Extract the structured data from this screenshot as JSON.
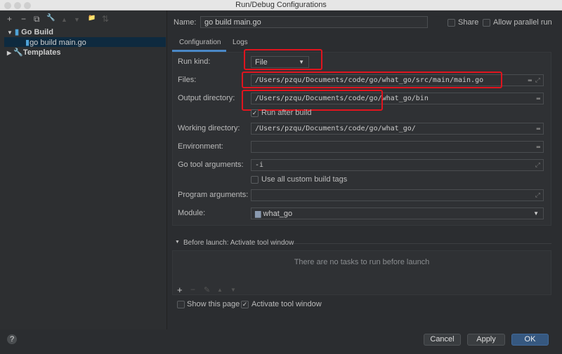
{
  "window": {
    "title": "Run/Debug Configurations"
  },
  "sidebar": {
    "toolbar": [
      "+",
      "−",
      "⧉",
      "🔧",
      "▲",
      "▼",
      "📁",
      "⇅"
    ],
    "tree": [
      {
        "label": "Go Build",
        "expanded": true
      },
      {
        "label": "go build main.go",
        "selected": true
      },
      {
        "label": "Templates",
        "expanded": false
      }
    ]
  },
  "header": {
    "name_label": "Name:",
    "name_value": "go build main.go",
    "share_label": "Share",
    "share_checked": false,
    "parallel_label": "Allow parallel run",
    "parallel_checked": false
  },
  "tabs": [
    {
      "label": "Configuration",
      "active": true
    },
    {
      "label": "Logs",
      "active": false
    }
  ],
  "form": {
    "run_kind_label": "Run kind:",
    "run_kind_value": "File",
    "files_label": "Files:",
    "files_value": "/Users/pzqu/Documents/code/go/what_go/src/main/main.go",
    "output_label": "Output directory:",
    "output_value": "/Users/pzqu/Documents/code/go/what_go/bin",
    "run_after_build_label": "Run after build",
    "run_after_build_checked": true,
    "working_label": "Working directory:",
    "working_value": "/Users/pzqu/Documents/code/go/what_go/",
    "env_label": "Environment:",
    "env_value": "",
    "go_tool_label": "Go tool arguments:",
    "go_tool_value": "-i",
    "custom_tags_label": "Use all custom build tags",
    "custom_tags_checked": false,
    "program_label": "Program arguments:",
    "program_value": "",
    "module_label": "Module:",
    "module_value": "what_go"
  },
  "before_launch": {
    "title": "Before launch: Activate tool window",
    "empty_text": "There are no tasks to run before launch",
    "toolbar": [
      "+",
      "−",
      "✎",
      "▲",
      "▼"
    ],
    "show_page_label": "Show this page",
    "show_page_checked": false,
    "activate_label": "Activate tool window",
    "activate_checked": true
  },
  "buttons": {
    "help": "?",
    "cancel": "Cancel",
    "apply": "Apply",
    "ok": "OK"
  },
  "colors": {
    "accent": "#4a88c7",
    "highlight": "#e0141e",
    "ok_button": "#365880"
  }
}
